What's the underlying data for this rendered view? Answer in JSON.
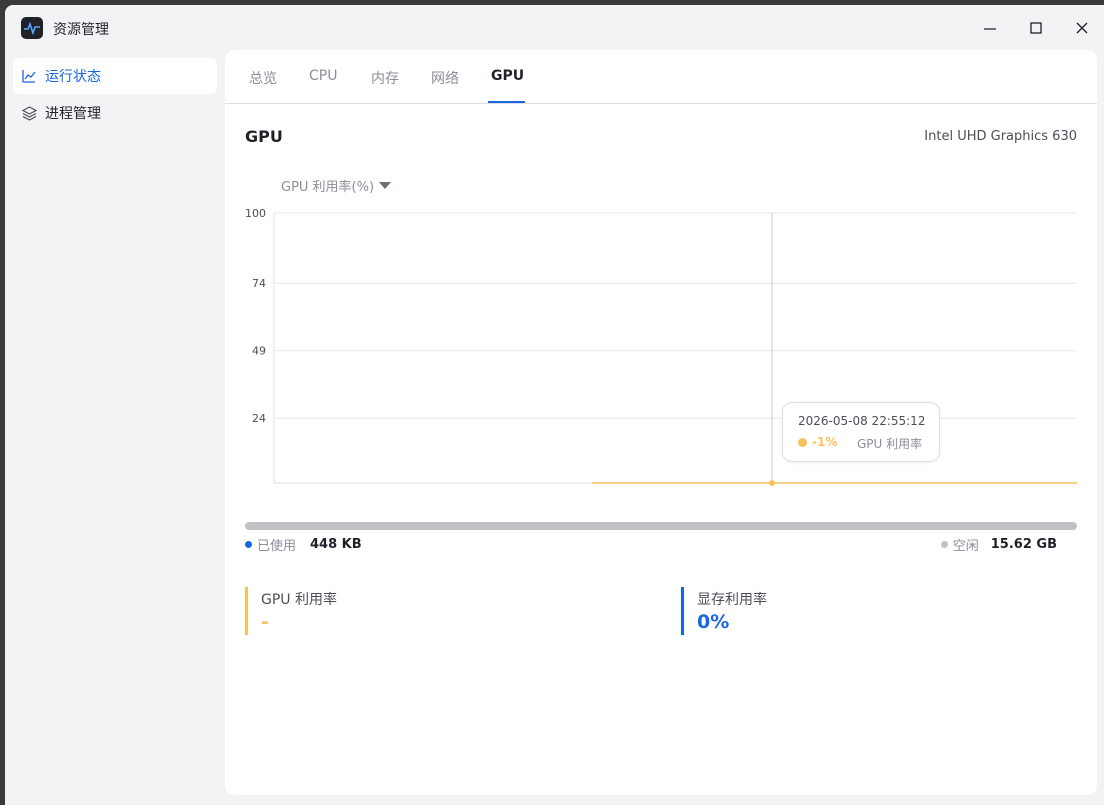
{
  "app": {
    "title": "资源管理"
  },
  "sidebar": {
    "items": [
      {
        "label": "运行状态",
        "icon": "line-chart-icon",
        "active": true
      },
      {
        "label": "进程管理",
        "icon": "layers-icon",
        "active": false
      }
    ]
  },
  "tabs": [
    {
      "label": "总览"
    },
    {
      "label": "CPU"
    },
    {
      "label": "内存"
    },
    {
      "label": "网络"
    },
    {
      "label": "GPU",
      "active": true
    }
  ],
  "section": {
    "title": "GPU",
    "gpu_name": "Intel UHD Graphics 630"
  },
  "metric_selector": {
    "label": "GPU 利用率(%)"
  },
  "chart_data": {
    "type": "line",
    "y_ticks": [
      "100",
      "74",
      "49",
      "24"
    ],
    "ylim": [
      0,
      100
    ],
    "grid": true,
    "series": [
      {
        "name": "GPU 利用率",
        "color": "#f7c25b",
        "values": [
          0,
          0
        ]
      }
    ]
  },
  "tooltip": {
    "time": "2026-05-08 22:55:12",
    "value": "-1%",
    "series": "GPU 利用率"
  },
  "memory": {
    "used_label": "已使用",
    "used_value": "448 KB",
    "free_label": "空闲",
    "free_value": "15.62 GB",
    "used_fraction": 3e-05
  },
  "stats": [
    {
      "label": "GPU 利用率",
      "value": "-",
      "color": "#f7c25b"
    },
    {
      "label": "显存利用率",
      "value": "0%",
      "color": "#1a66e0"
    }
  ],
  "colors": {
    "accent": "#1a66e0",
    "gpu_series": "#f7c25b",
    "free": "#c0c2c6"
  }
}
